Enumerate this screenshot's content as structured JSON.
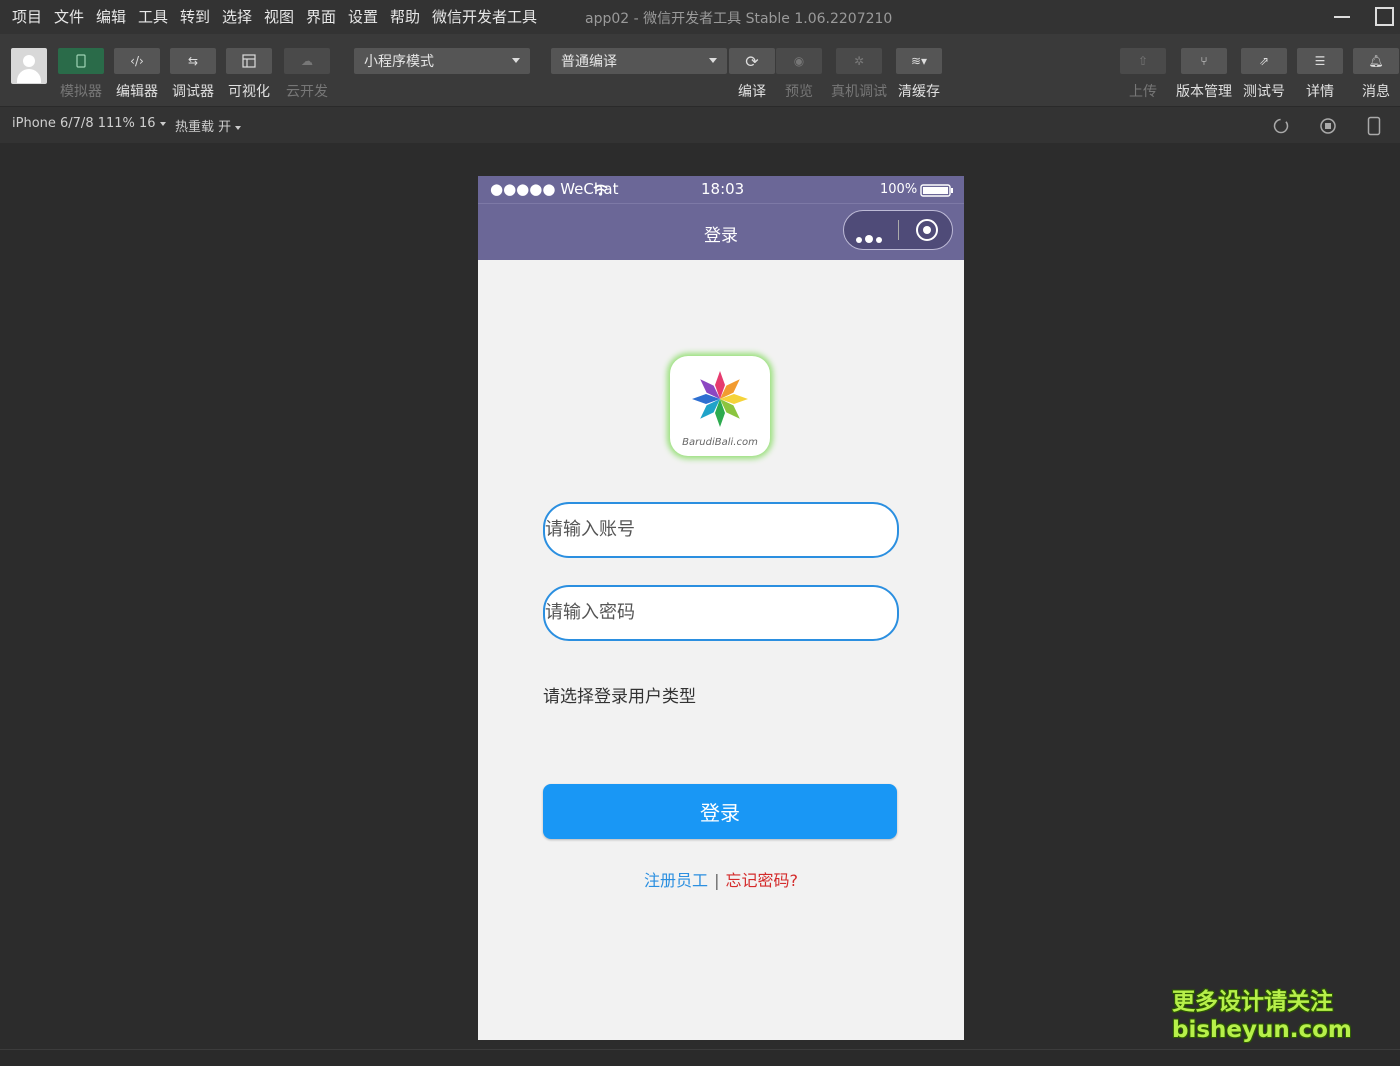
{
  "menu": [
    "项目",
    "文件",
    "编辑",
    "工具",
    "转到",
    "选择",
    "视图",
    "界面",
    "设置",
    "帮助",
    "微信开发者工具"
  ],
  "window_title": "app02 - 微信开发者工具 Stable 1.06.2207210",
  "toolbar": {
    "simulator": "模拟器",
    "editor": "编辑器",
    "debugger": "调试器",
    "visualize": "可视化",
    "cloud": "云开发",
    "mode_select": "小程序模式",
    "compile_select": "普通编译",
    "compile": "编译",
    "preview": "预览",
    "remote_debug": "真机调试",
    "clear_cache": "清缓存",
    "upload": "上传",
    "version": "版本管理",
    "test_account": "测试号",
    "details": "详情",
    "messages": "消息"
  },
  "subbar": {
    "device": "iPhone 6/7/8 111% 16",
    "hot_reload": "热重载 开"
  },
  "phone": {
    "carrier": "●●●●● WeChat",
    "time": "18:03",
    "battery": "100%",
    "nav_title": "登录",
    "logo_text": "BarudiBali.com",
    "account_placeholder": "请输入账号",
    "password_placeholder": "请输入密码",
    "user_type_label": "请选择登录用户类型",
    "login_button": "登录",
    "register_link": "注册员工",
    "separator": "|",
    "forgot_link": "忘记密码?"
  },
  "watermark": {
    "line1": "更多设计请关注",
    "line2": "bisheyun.com"
  },
  "colors": {
    "nav_bg": "#6b6797",
    "accent": "#1997f5",
    "input_border": "#2b8fe0",
    "forgot": "#d42b2b"
  }
}
